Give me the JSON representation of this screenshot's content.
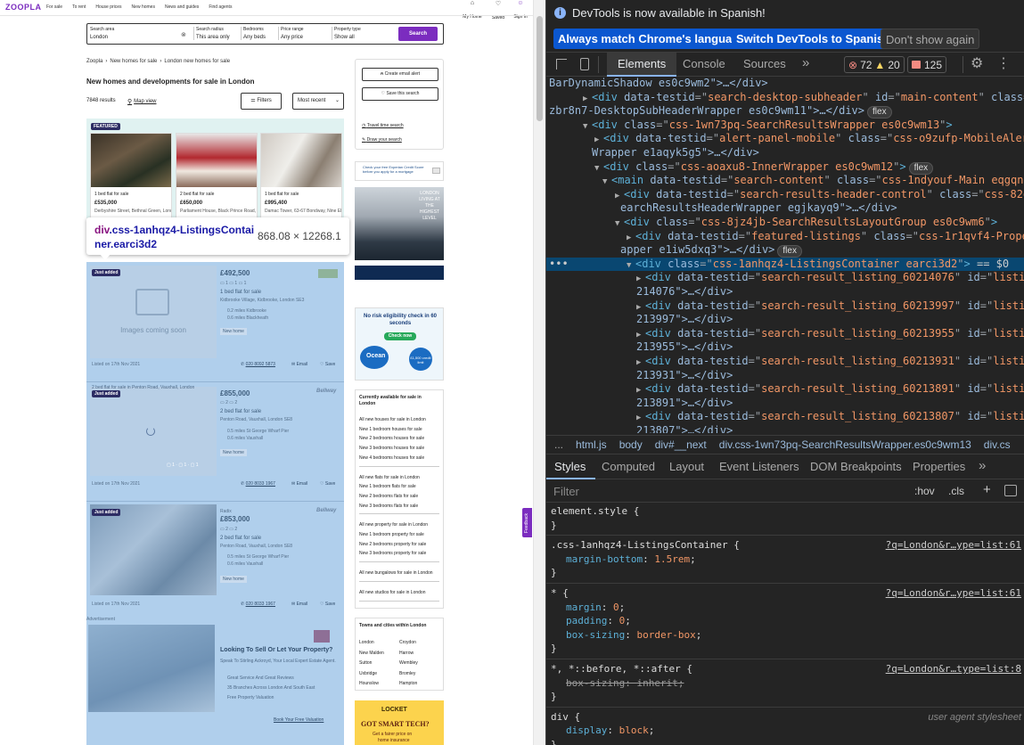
{
  "site": {
    "logo": "ZOOPLA",
    "nav": [
      "For sale",
      "To rent",
      "House prices",
      "New homes",
      "News and guides",
      "Find agents"
    ],
    "my_home": "My Home",
    "saved": "Saved",
    "sign_in": "Sign in"
  },
  "search": {
    "area_label": "Search area",
    "area_value": "London",
    "radius_label": "Search radius",
    "radius_value": "This area only",
    "bedrooms_label": "Bedrooms",
    "bedrooms_value": "Any beds",
    "price_label": "Price range",
    "price_value": "Any price",
    "type_label": "Property type",
    "type_value": "Show all",
    "button": "Search"
  },
  "breadcrumb": [
    "Zoopla",
    "New homes for sale",
    "London new homes for sale"
  ],
  "page_title": "New homes and developments for sale in London",
  "results": {
    "count": "7848 results",
    "map": "Map view",
    "filters": "Filters",
    "sort": "Most recent"
  },
  "featured": {
    "label": "FEATURED",
    "cards": [
      {
        "title": "1 bed flat for sale",
        "price": "£535,000",
        "address": "Derbyshire Street, Bethnal Green, London E2"
      },
      {
        "title": "2 bed flat for sale",
        "price": "£650,000",
        "address": "Parliament House, Black Prince Road, Nine Elms SE1"
      },
      {
        "title": "1 bed flat for sale",
        "price": "£995,400",
        "address": "Damac Tower, 63-67 Bondway, Nine Elms, London SW8"
      }
    ]
  },
  "tooltip": {
    "selector_tag": "div",
    "selector_class": ".css-1anhqz4-ListingsContainer.earci3d2",
    "size": "868.08 × 12268.1"
  },
  "listings": [
    {
      "badge": "Just added",
      "price": "£492,500",
      "title": "1 bed flat for sale",
      "address": "Kidbrooke Village, Kidbrooke, London SE3",
      "t1": "0.2 miles Kidbrooke",
      "t2": "0.6 miles Blackheath",
      "tag": "New home",
      "listed": "Listed on 17th Nov 2021",
      "phone": "020 8092 5873",
      "email": "Email",
      "save": "Save",
      "no_image": "Images coming soon"
    },
    {
      "badge": "Just added",
      "headline": "2 bed flat for sale in Penton Road, Vauxhall, London",
      "price": "£855,000",
      "title": "2 bed flat for sale",
      "address": "Penton Road, Vauxhall, London SE8",
      "t1": "0.5 miles St George Wharf Pier",
      "t2": "0.6 miles Vauxhall",
      "tag": "New home",
      "listed": "Listed on 17th Nov 2021",
      "phone": "020 8033 1967",
      "email": "Email",
      "save": "Save",
      "brand": "Bellway"
    },
    {
      "badge": "Just added",
      "kicker": "Radix",
      "price": "£853,000",
      "title": "2 bed flat for sale",
      "address": "Penton Road, Vauxhall, London SE8",
      "t1": "0.5 miles St George Wharf Pier",
      "t2": "0.6 miles Vauxhall",
      "tag": "New home",
      "listed": "Listed on 17th Nov 2021",
      "phone": "020 8033 1967",
      "email": "Email",
      "save": "Save",
      "brand": "Bellway"
    }
  ],
  "advert": {
    "label": "Advertisement",
    "title": "Looking To Sell Or Let Your Property?",
    "sub": "Speak To Stirling Ackroyd, Your Local Expert Estate Agent.",
    "b1": "Great Service And Great Reviews",
    "b2": "35 Branches Across London And South East",
    "b3": "Free Property Valuation",
    "cta": "Book Your Free Valuation"
  },
  "sidebar": {
    "alert": "Create email alert",
    "save": "Save this search",
    "travel": "Travel time search",
    "draw": "Draw your search",
    "experian": "Check your free Experian Credit Score before you apply for a mortgage",
    "banner": "LONDON LIVING AT THE HIGHEST LEVEL",
    "ocean1": "No risk eligibility check in 60 seconds",
    "ocean_btn": "Check now",
    "ocean_brand": "Ocean",
    "ocean_apr": "£1,500 credit limit",
    "currently_title": "Currently available for sale in London",
    "groups": [
      [
        "All new houses for sale in London",
        "New 1 bedroom houses for sale",
        "New 2 bedrooms houses for sale",
        "New 3 bedrooms houses for sale",
        "New 4 bedrooms houses for sale"
      ],
      [
        "All new flats for sale in London",
        "New 1 bedroom flats for sale",
        "New 2 bedrooms flats for sale",
        "New 3 bedrooms flats for sale"
      ],
      [
        "All new property for sale in London",
        "New 1 bedroom property for sale",
        "New 2 bedrooms property for sale",
        "New 3 bedrooms property for sale"
      ],
      [
        "All new bungalows for sale in London"
      ],
      [
        "All new studios for sale in London"
      ]
    ],
    "towns_title": "Towns and cities within London",
    "towns": [
      "London",
      "Croydon",
      "New Malden",
      "Harrow",
      "Sutton",
      "Wembley",
      "Uxbridge",
      "Bromley",
      "Hounslow",
      "Hampton"
    ],
    "locket": "LOCKET",
    "locket2": "GOT SMART TECH?",
    "locket3": "Get a fairer price on",
    "locket4": "home insurance",
    "feedback": "Feedback"
  },
  "devtools": {
    "notice": "DevTools is now available in Spanish!",
    "btn1": "Always match Chrome's language",
    "btn2": "Switch DevTools to Spanish",
    "btn3": "Don't show again",
    "tabs": [
      "Elements",
      "Console",
      "Sources"
    ],
    "errors": "72",
    "warnings": "20",
    "issues": "125",
    "dom": [
      {
        "in": 0,
        "raw": "BarDynamicShadow es0c9wm2\">…</div>"
      },
      {
        "in": 3,
        "tri": "▶",
        "tag": "div",
        "attrs": [
          [
            "data-testid",
            "search-desktop-subheader"
          ],
          [
            "id",
            "main-content"
          ],
          [
            "class",
            "css-"
          ]
        ]
      },
      {
        "in": 0,
        "raw": "zbr8n7-DesktopSubHeaderWrapper es0c9wm11\">…</div>",
        "badge": "flex"
      },
      {
        "in": 3,
        "tri": "▼",
        "tag": "div",
        "attrs": [
          [
            "class",
            "css-1wn73pq-SearchResultsWrapper es0c9wm13"
          ]
        ]
      },
      {
        "in": 4,
        "tri": "▶",
        "tag": "div",
        "attrs": [
          [
            "data-testid",
            "alert-panel-mobile"
          ],
          [
            "class",
            "css-o9zufp-MobileAlertPanel"
          ]
        ]
      },
      {
        "in": 4,
        "raw": "Wrapper e1aqyk5g5\">…</div>"
      },
      {
        "in": 4,
        "tri": "▼",
        "tag": "div",
        "attrs": [
          [
            "class",
            "css-aoaxu8-InnerWrapper es0c9wm12"
          ]
        ],
        "badge": "flex"
      },
      {
        "in": 5,
        "tri": "▼",
        "tag": "main",
        "attrs": [
          [
            "data-testid",
            "search-content"
          ],
          [
            "class",
            "css-1ndyouf-Main eqgqnb30"
          ]
        ]
      },
      {
        "in": 6,
        "tri": "▶",
        "tag": "div",
        "attrs": [
          [
            "data-testid",
            "search-results-header-control"
          ],
          [
            "class",
            "css-82dcw0-S"
          ]
        ]
      },
      {
        "in": 6,
        "raw": "earchResultsHeaderWrapper egjkayq9\">…</div>"
      },
      {
        "in": 6,
        "tri": "▼",
        "tag": "div",
        "attrs": [
          [
            "class",
            "css-8jz4jb-SearchResultsLayoutGroup es0c9wm6"
          ]
        ]
      },
      {
        "in": 7,
        "tri": "▶",
        "tag": "div",
        "attrs": [
          [
            "data-testid",
            "featured-listings"
          ],
          [
            "class",
            "css-1r1qvf4-PropertyWr"
          ]
        ]
      },
      {
        "in": 7,
        "raw": "apper e1iw5dxq3\">…</div>",
        "badge": "flex"
      },
      {
        "in": 7,
        "tri": "▼",
        "tag": "div",
        "attrs": [
          [
            "class",
            "css-1anhqz4-ListingsContainer earci3d2"
          ]
        ],
        "sel": true
      },
      {
        "in": 8,
        "tri": "▶",
        "tag": "div",
        "attrs": [
          [
            "data-testid",
            "search-result_listing_60214076"
          ],
          [
            "id",
            "listing_60"
          ]
        ]
      },
      {
        "in": 8,
        "raw": "214076\">…</div>"
      },
      {
        "in": 8,
        "tri": "▶",
        "tag": "div",
        "attrs": [
          [
            "data-testid",
            "search-result_listing_60213997"
          ],
          [
            "id",
            "listing_60"
          ]
        ]
      },
      {
        "in": 8,
        "raw": "213997\">…</div>"
      },
      {
        "in": 8,
        "tri": "▶",
        "tag": "div",
        "attrs": [
          [
            "data-testid",
            "search-result_listing_60213955"
          ],
          [
            "id",
            "listing_60"
          ]
        ]
      },
      {
        "in": 8,
        "raw": "213955\">…</div>"
      },
      {
        "in": 8,
        "tri": "▶",
        "tag": "div",
        "attrs": [
          [
            "data-testid",
            "search-result_listing_60213931"
          ],
          [
            "id",
            "listing_60"
          ]
        ]
      },
      {
        "in": 8,
        "raw": "213931\">…</div>"
      },
      {
        "in": 8,
        "tri": "▶",
        "tag": "div",
        "attrs": [
          [
            "data-testid",
            "search-result_listing_60213891"
          ],
          [
            "id",
            "listing_60"
          ]
        ]
      },
      {
        "in": 8,
        "raw": "213891\">…</div>"
      },
      {
        "in": 8,
        "tri": "▶",
        "tag": "div",
        "attrs": [
          [
            "data-testid",
            "search-result_listing_60213807"
          ],
          [
            "id",
            "listing_60"
          ]
        ]
      },
      {
        "in": 8,
        "raw": "213807\">…</div>"
      }
    ],
    "sel_suffix": "== $0",
    "crumbs": [
      "...",
      "html.js",
      "body",
      "div#__next",
      "div.css-1wn73pq-SearchResultsWrapper.es0c9wm13",
      "div.cs"
    ],
    "style_tabs": [
      "Styles",
      "Computed",
      "Layout",
      "Event Listeners",
      "DOM Breakpoints",
      "Properties"
    ],
    "filter": "Filter",
    "hov": ":hov",
    "cls": ".cls",
    "styles": [
      {
        "sel": "element.style {",
        "props": [],
        "close": "}"
      },
      {
        "sel": ".css-1anhqz4-ListingsContainer {",
        "src": "?q=London&r…ype=list:61",
        "props": [
          [
            "margin-bottom",
            "1.5rem"
          ]
        ],
        "close": "}"
      },
      {
        "sel": "* {",
        "src": "?q=London&r…ype=list:61",
        "props": [
          [
            "margin",
            "0"
          ],
          [
            "padding",
            "0"
          ],
          [
            "box-sizing",
            "border-box"
          ]
        ],
        "close": "}"
      },
      {
        "sel": "*, *::before, *::after {",
        "src": "?q=London&r…type=list:8",
        "props": [
          [
            "box-sizing",
            "inherit"
          ]
        ],
        "strike": true,
        "close": "}"
      },
      {
        "sel": "div {",
        "src": "user agent stylesheet",
        "props": [
          [
            "display",
            "block"
          ]
        ],
        "close": "}"
      }
    ]
  }
}
